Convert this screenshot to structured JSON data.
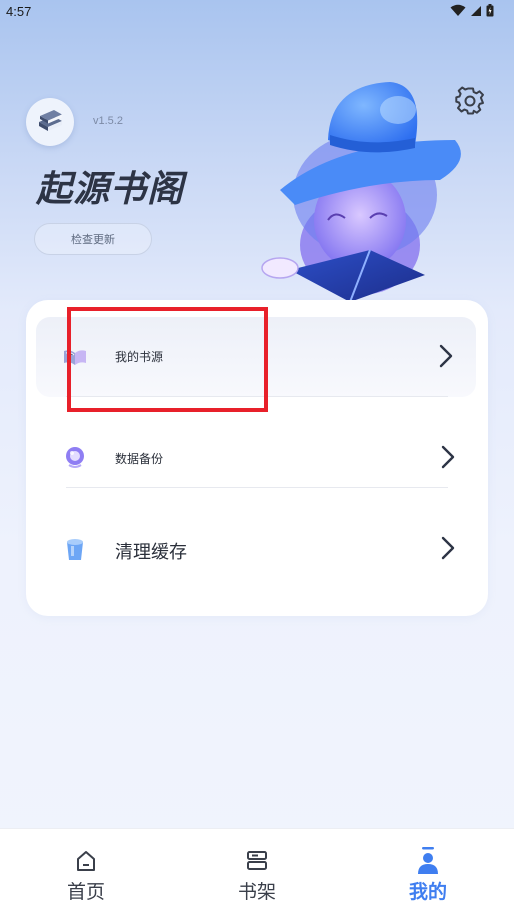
{
  "status_bar": {
    "time": "4:57"
  },
  "header": {
    "version": "v1.5.2",
    "app_title": "起源书阁",
    "update_button": "检查更新"
  },
  "menu": {
    "items": [
      {
        "label": "我的书源",
        "icon": "book-sources-icon"
      },
      {
        "label": "数据备份",
        "icon": "backup-icon"
      },
      {
        "label": "清理缓存",
        "icon": "clear-cache-icon"
      }
    ]
  },
  "bottom_nav": {
    "items": [
      {
        "label": "首页",
        "icon": "home-icon",
        "active": false
      },
      {
        "label": "书架",
        "icon": "bookshelf-icon",
        "active": false
      },
      {
        "label": "我的",
        "icon": "profile-icon",
        "active": true
      }
    ]
  },
  "colors": {
    "accent": "#3f7ef0",
    "highlight": "#e8202a"
  }
}
